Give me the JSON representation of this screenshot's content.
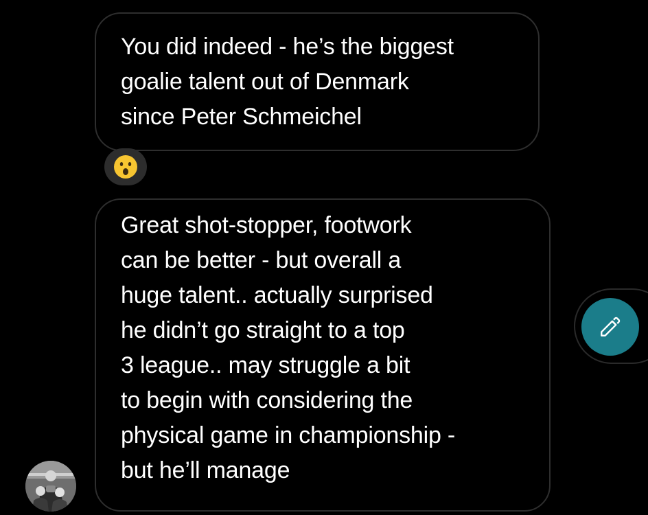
{
  "conversation": {
    "messages": [
      {
        "lines": [
          "You did indeed - he’s the biggest",
          "goalie talent out of Denmark",
          "since Peter Schmeichel"
        ],
        "reaction": "surprised-face-emoji"
      },
      {
        "lines": [
          "Great shot-stopper, footwork",
          "can be better - but overall a",
          "huge talent.. actually surprised",
          "he didn’t go straight to a top",
          "3 league.. may struggle a bit",
          "to begin with considering the",
          "physical game in championship -",
          "but he’ll manage"
        ]
      }
    ],
    "sender_avatar": "sender-avatar-photo"
  },
  "actions": {
    "compose_icon": "pencil-icon"
  },
  "colors": {
    "background": "#000000",
    "bubble_border": "#2e2e2e",
    "text": "#ffffff",
    "reaction_bg": "#2d2d2d",
    "fab_accent": "#1b7d8a"
  }
}
